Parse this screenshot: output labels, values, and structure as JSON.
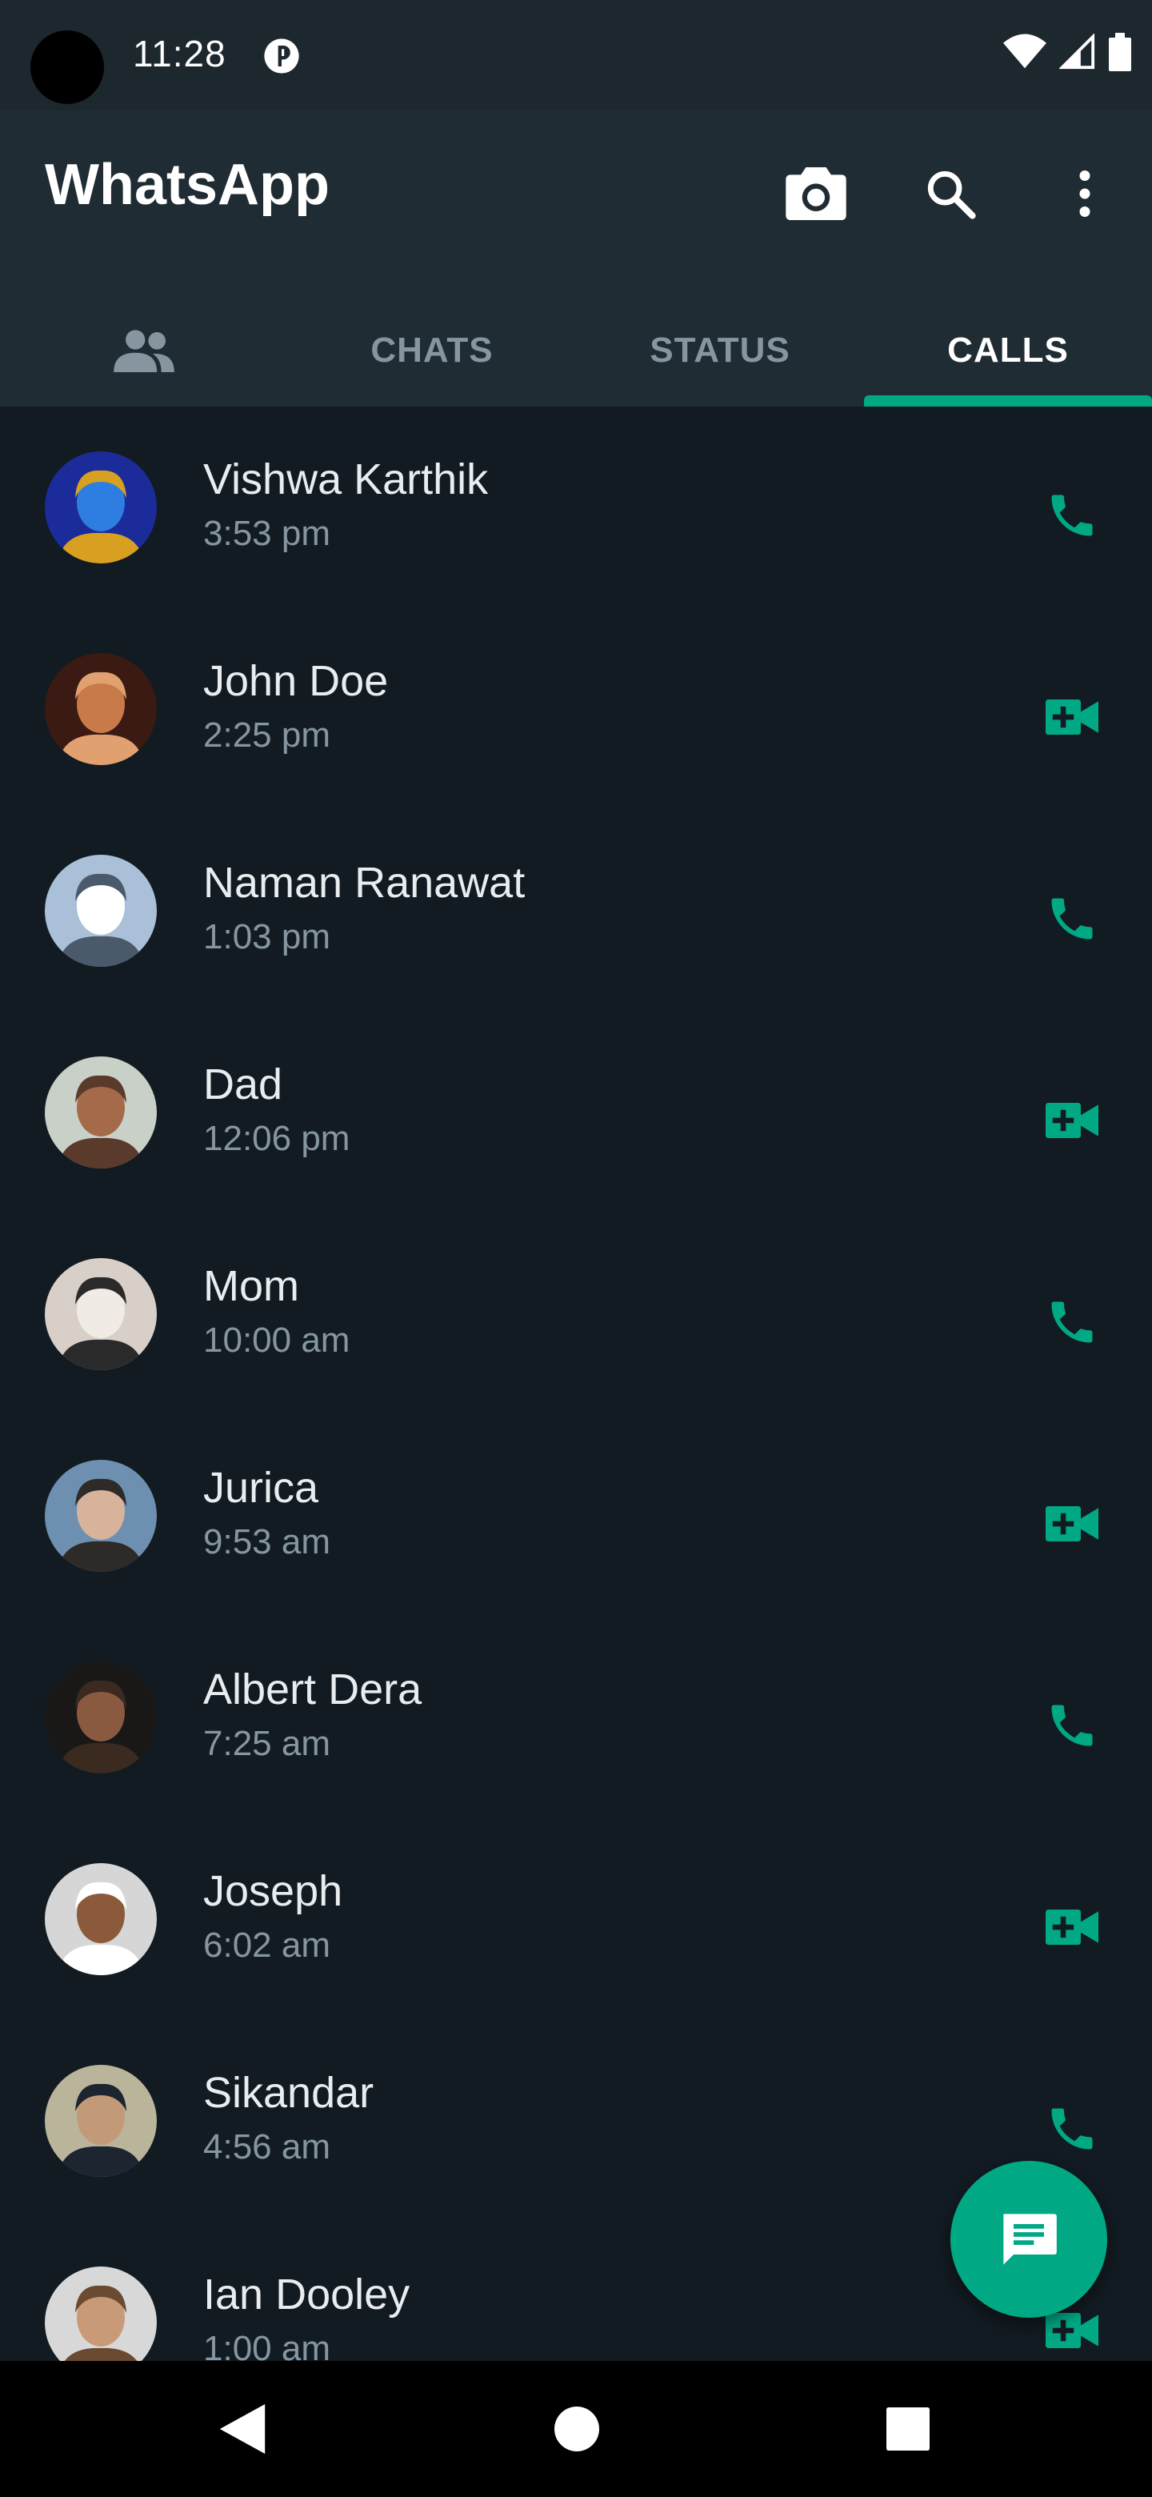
{
  "status_bar": {
    "time": "11:28"
  },
  "app_bar": {
    "title": "WhatsApp",
    "actions": [
      "camera-icon",
      "search-icon",
      "more-vert-icon"
    ]
  },
  "tabs": [
    {
      "label": "",
      "icon": "community-icon"
    },
    {
      "label": "CHATS"
    },
    {
      "label": "STATUS"
    },
    {
      "label": "CALLS",
      "selected": true
    }
  ],
  "calls": [
    {
      "name": "Vishwa Karthik",
      "time": "3:53 pm",
      "type": "voice",
      "avatar_colors": [
        "#1b2c9a",
        "#2e7de0",
        "#d8a020"
      ]
    },
    {
      "name": "John Doe",
      "time": "2:25 pm",
      "type": "video",
      "avatar_colors": [
        "#3a1a12",
        "#c87a4a",
        "#e0a070"
      ]
    },
    {
      "name": "Naman Ranawat",
      "time": "1:03 pm",
      "type": "voice",
      "avatar_colors": [
        "#a9c0d8",
        "#ffffff",
        "#4a5a6a"
      ]
    },
    {
      "name": "Dad",
      "time": "12:06 pm",
      "type": "video",
      "avatar_colors": [
        "#c9d0c8",
        "#a56a4a",
        "#5a3a2a"
      ]
    },
    {
      "name": "Mom",
      "time": "10:00 am",
      "type": "voice",
      "avatar_colors": [
        "#d8cfc8",
        "#f1ebe6",
        "#2a2a2a"
      ]
    },
    {
      "name": "Jurica",
      "time": "9:53 am",
      "type": "video",
      "avatar_colors": [
        "#6d8fb0",
        "#d6b39a",
        "#2e2a28"
      ]
    },
    {
      "name": "Albert Dera",
      "time": "7:25 am",
      "type": "voice",
      "avatar_colors": [
        "#1a1816",
        "#8a5a40",
        "#3a2a20"
      ]
    },
    {
      "name": "Joseph",
      "time": "6:02 am",
      "type": "video",
      "avatar_colors": [
        "#d6d6d6",
        "#8a5a3a",
        "#ffffff"
      ]
    },
    {
      "name": "Sikandar",
      "time": "4:56 am",
      "type": "voice",
      "avatar_colors": [
        "#b9b49a",
        "#c39a78",
        "#1c2530"
      ]
    },
    {
      "name": "Ian Dooley",
      "time": "1:00 am",
      "type": "video",
      "avatar_colors": [
        "#d8d8d8",
        "#c89a78",
        "#6a4a30"
      ]
    }
  ],
  "colors": {
    "accent": "#00a884",
    "background": "#121b22",
    "app_bar": "#202c33",
    "status_bar": "#1d272e",
    "secondary_text": "#8696a0"
  }
}
